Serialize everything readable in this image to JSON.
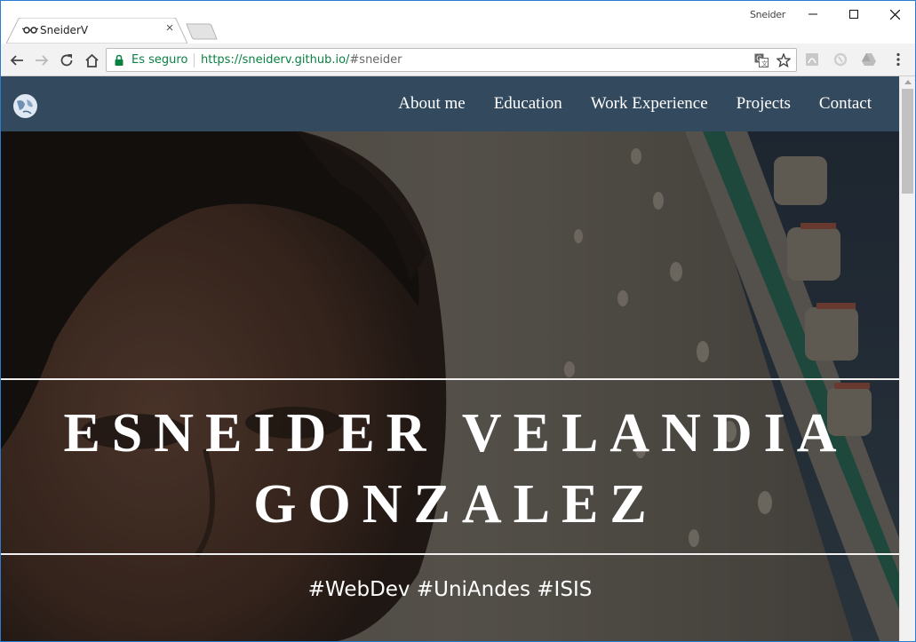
{
  "browser": {
    "tab_title": "SneiderV",
    "tab_close": "×",
    "profile_name": "Sneider",
    "security_label": "Es seguro",
    "url_host": "https://sneiderv.github.io/",
    "url_rest": "#sneider"
  },
  "site": {
    "nav": {
      "items": [
        "About me",
        "Education",
        "Work Experience",
        "Projects",
        "Contact"
      ]
    },
    "hero": {
      "name_line1": "ESNEIDER VELANDIA",
      "name_line2": "GONZALEZ",
      "tags": "#WebDev #UniAndes #ISIS"
    }
  },
  "colors": {
    "nav_background": "#334a5e",
    "secure_green": "#0b8043",
    "window_border": "#2b7bd1"
  }
}
